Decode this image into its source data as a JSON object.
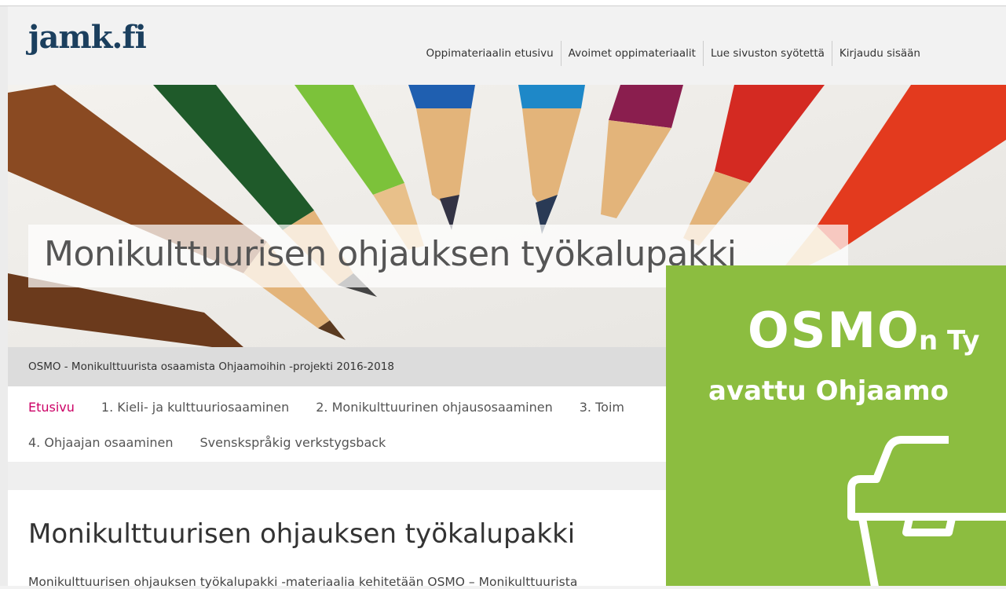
{
  "header": {
    "logo": "jamk.fi",
    "nav": [
      "Oppimateriaalin etusivu",
      "Avoimet oppimateriaalit",
      "Lue sivuston syötettä",
      "Kirjaudu sisään"
    ]
  },
  "hero": {
    "title": "Monikulttuurisen ohjauksen työkalupakki"
  },
  "subtitle": "OSMO - Monikulttuurista osaamista Ohjaamoihin -projekti 2016-2018",
  "mainnav": {
    "row1": [
      "Etusivu",
      "1. Kieli- ja kulttuuriosaaminen",
      "2. Monikulttuurinen ohjausosaaminen",
      "3. Toim"
    ],
    "row2": [
      "4. Ohjaajan osaaminen",
      "Svenskspråkig verkstygsback"
    ],
    "active": "Etusivu"
  },
  "content": {
    "heading": "Monikulttuurisen ohjauksen työkalupakki",
    "intro": "Monikulttuurisen ohjauksen työkalupakki -materiaalia kehitetään OSMO – Monikulttuurista"
  },
  "popup": {
    "brand": "OSMO",
    "line1_suffix": "n Ty",
    "line2": "avattu Ohjaamo",
    "icon": "toolbox-icon"
  },
  "colors": {
    "logo": "#1b3f5e",
    "active_nav": "#cc0066",
    "popup_bg": "#8cbd40"
  }
}
